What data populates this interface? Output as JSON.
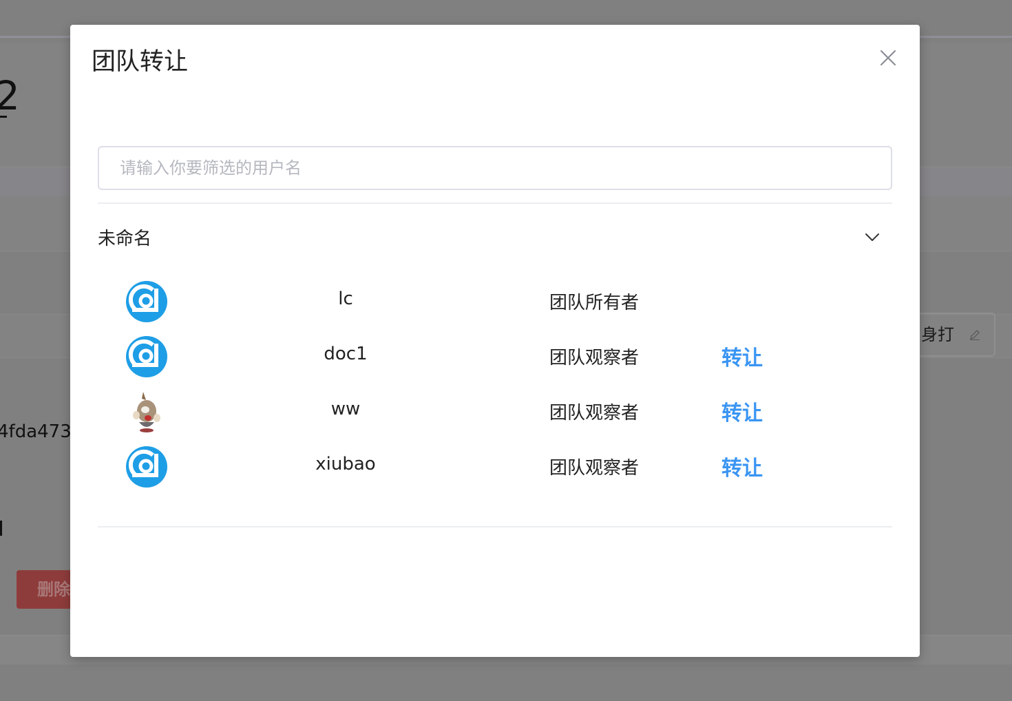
{
  "background": {
    "title_fragment": "2",
    "id_fragment": "4fda473",
    "delete_button_label": "删除",
    "right_field_label": "身打"
  },
  "modal": {
    "title": "团队转让",
    "close_icon": "close-icon",
    "search": {
      "value": "",
      "placeholder": "请输入你要筛选的用户名"
    },
    "group": {
      "title": "未命名",
      "expanded": true,
      "chevron_icon": "chevron-down-icon"
    },
    "members": [
      {
        "name": "lc",
        "role": "团队所有者",
        "avatar": "logo-avatar",
        "action": ""
      },
      {
        "name": "doc1",
        "role": "团队观察者",
        "avatar": "logo-avatar",
        "action": "转让"
      },
      {
        "name": "ww",
        "role": "团队观察者",
        "avatar": "cartoon-avatar",
        "action": "转让"
      },
      {
        "name": "xiubao",
        "role": "团队观察者",
        "avatar": "logo-avatar",
        "action": "转让"
      }
    ],
    "colors": {
      "link": "#3a95f2",
      "avatar_blue": "#1e9ee6"
    }
  }
}
